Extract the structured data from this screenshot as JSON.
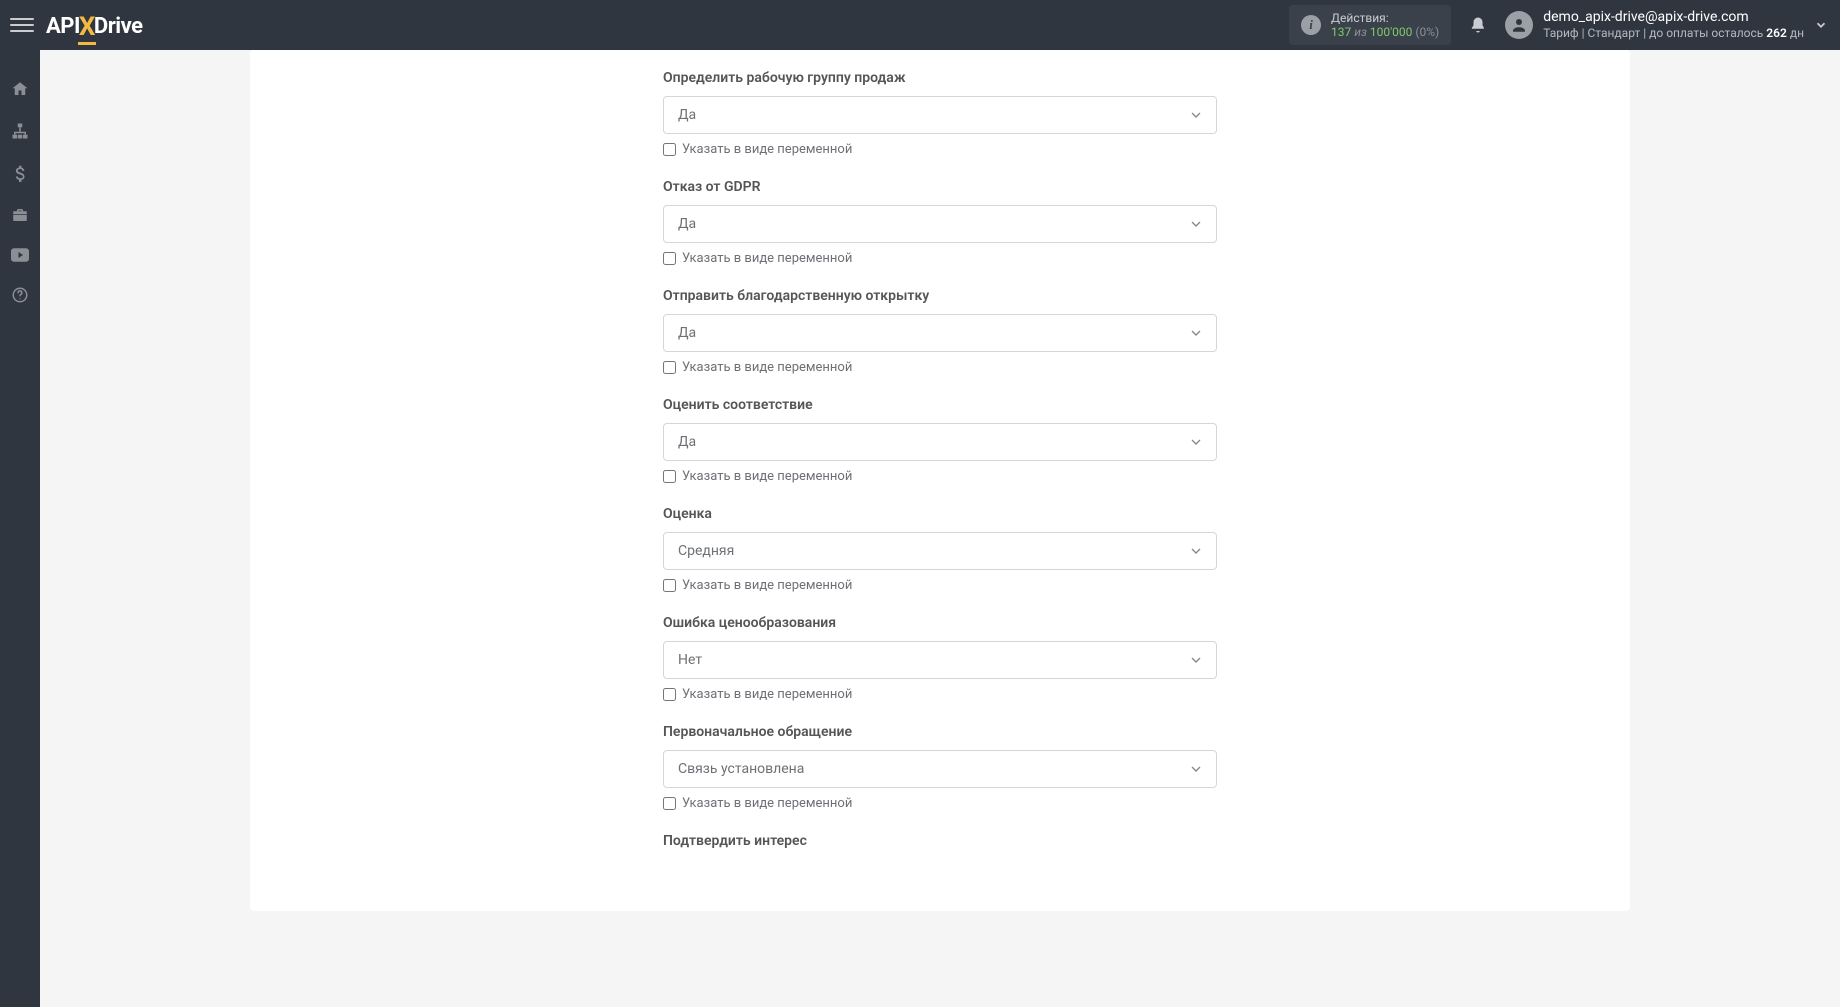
{
  "header": {
    "logo": {
      "api": "API",
      "x": "X",
      "drive": "Drive"
    },
    "actions": {
      "label": "Действия:",
      "n1": "137",
      "sep": "из",
      "n2": "100'000",
      "pct": "(0%)"
    },
    "user": {
      "email": "demo_apix-drive@apix-drive.com",
      "tariff_prefix": "Тариф | Стандарт | до оплаты осталось ",
      "days": "262",
      "days_suffix": " дн"
    }
  },
  "common": {
    "variable_checkbox_label": "Указать в виде переменной"
  },
  "fields": [
    {
      "label": "Определить рабочую группу продаж",
      "value": "Да"
    },
    {
      "label": "Отказ от GDPR",
      "value": "Да"
    },
    {
      "label": "Отправить благодарственную открытку",
      "value": "Да"
    },
    {
      "label": "Оценить соответствие",
      "value": "Да"
    },
    {
      "label": "Оценка",
      "value": "Средняя"
    },
    {
      "label": "Ошибка ценообразования",
      "value": "Нет"
    },
    {
      "label": "Первоначальное обращение",
      "value": "Связь установлена"
    },
    {
      "label": "Подтвердить интерес",
      "value": ""
    }
  ]
}
